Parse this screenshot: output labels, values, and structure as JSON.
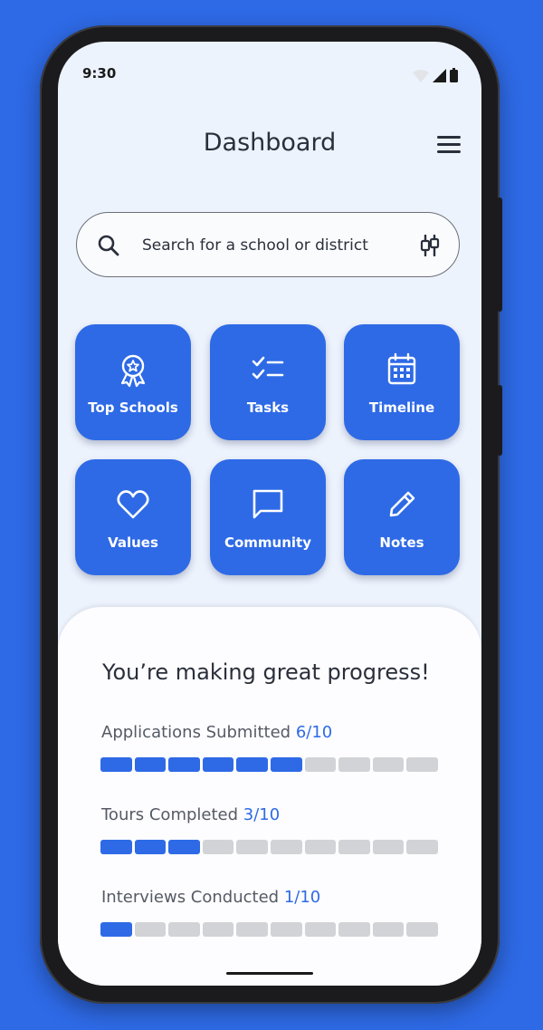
{
  "status_bar": {
    "time": "9:30",
    "icons": [
      "wifi-icon",
      "signal-icon",
      "battery-icon"
    ]
  },
  "header": {
    "title": "Dashboard",
    "menu_icon": "hamburger-menu-icon"
  },
  "search": {
    "placeholder": "Search for a school or district",
    "icon": "search-icon",
    "filter_icon": "filter-icon"
  },
  "tiles": [
    {
      "label": "Top Schools",
      "icon": "award-badge-icon"
    },
    {
      "label": "Tasks",
      "icon": "checklist-icon"
    },
    {
      "label": "Timeline",
      "icon": "calendar-icon"
    },
    {
      "label": "Values",
      "icon": "heart-icon"
    },
    {
      "label": "Community",
      "icon": "chat-bubble-icon"
    },
    {
      "label": "Notes",
      "icon": "pencil-icon"
    }
  ],
  "progress": {
    "heading": "You’re making great progress!",
    "metrics": [
      {
        "label": "Applications Submitted",
        "value_text": "6/10",
        "completed": 6,
        "total": 10
      },
      {
        "label": "Tours Completed",
        "value_text": "3/10",
        "completed": 3,
        "total": 10
      },
      {
        "label": "Interviews Conducted",
        "value_text": "1/10",
        "completed": 1,
        "total": 10
      }
    ]
  },
  "colors": {
    "accent": "#2e6ae6",
    "background": "#edf3fd",
    "segment_empty": "#d2d3d7",
    "text": "#2a2f3b"
  }
}
